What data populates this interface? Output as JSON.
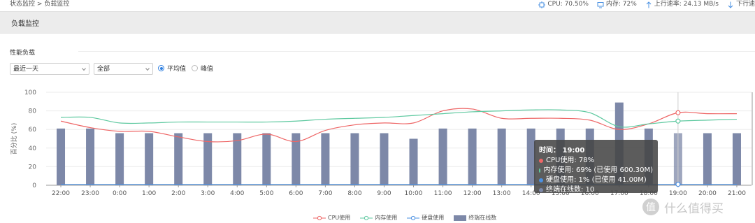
{
  "breadcrumb": {
    "level1": "状态监控",
    "sep": ">",
    "level2": "负载监控"
  },
  "status": {
    "cpu": "CPU: 70.50%",
    "memory": "内存: 72%",
    "upload": "上行速率: 24.13 MB/s",
    "download": "下行速"
  },
  "section_title": "负载监控",
  "perf_label": "性能负载",
  "filters": {
    "range": "最近一天",
    "scope": "全部",
    "radio_avg": "平均值",
    "radio_peak": "峰值"
  },
  "colors": {
    "cpu": "#ee6666",
    "mem": "#5fc9a0",
    "disk": "#4a90e2",
    "terminal": "#7d88a8"
  },
  "chart_data": {
    "type": "bar",
    "x": [
      "22:00",
      "23:00",
      "0:00",
      "1:00",
      "2:00",
      "3:00",
      "4:00",
      "5:00",
      "6:00",
      "7:00",
      "8:00",
      "9:00",
      "10:00",
      "11:00",
      "12:00",
      "13:00",
      "14:00",
      "15:00",
      "16:00",
      "17:00",
      "18:00",
      "19:00",
      "20:00",
      "21:00"
    ],
    "ylabel": "百分比 (%)",
    "ylim": [
      0,
      100
    ],
    "yticks": [
      0,
      20,
      40,
      60,
      80,
      100
    ],
    "series": [
      {
        "name": "CPU使用",
        "type": "line",
        "values": [
          69,
          62,
          58,
          58,
          52,
          47,
          48,
          55,
          47,
          59,
          65,
          67,
          67,
          80,
          82,
          72,
          72,
          72,
          70,
          60,
          66,
          78,
          77,
          77
        ]
      },
      {
        "name": "内存使用",
        "type": "line",
        "values": [
          73,
          73,
          67,
          67,
          68,
          68,
          68,
          68,
          69,
          71,
          72,
          73,
          75,
          77,
          79,
          80,
          81,
          81,
          78,
          63,
          66,
          69,
          70,
          71
        ]
      },
      {
        "name": "硬盘使用",
        "type": "line",
        "values": [
          1,
          1,
          1,
          1,
          1,
          1,
          1,
          1,
          1,
          1,
          1,
          1,
          1,
          1,
          1,
          1,
          1,
          1,
          1,
          1,
          1,
          1,
          1,
          1
        ]
      },
      {
        "name": "终端在线数",
        "type": "bar",
        "values": [
          61,
          61,
          56,
          56,
          56,
          56,
          56,
          56,
          56,
          56,
          56,
          56,
          50,
          61,
          61,
          61,
          61,
          61,
          61,
          89,
          61,
          56,
          56,
          56
        ]
      }
    ],
    "legend_position": "bottom",
    "grid": true
  },
  "tooltip": {
    "title": "时间： 19:00",
    "cpu": "CPU使用: 78%",
    "mem": "内存使用: 69%  (已使用 600.30M)",
    "disk": "硬盘使用: 1%  (已使用 41.00M)",
    "terminal": "终端在线数: 10"
  },
  "watermark": "什么值得买"
}
